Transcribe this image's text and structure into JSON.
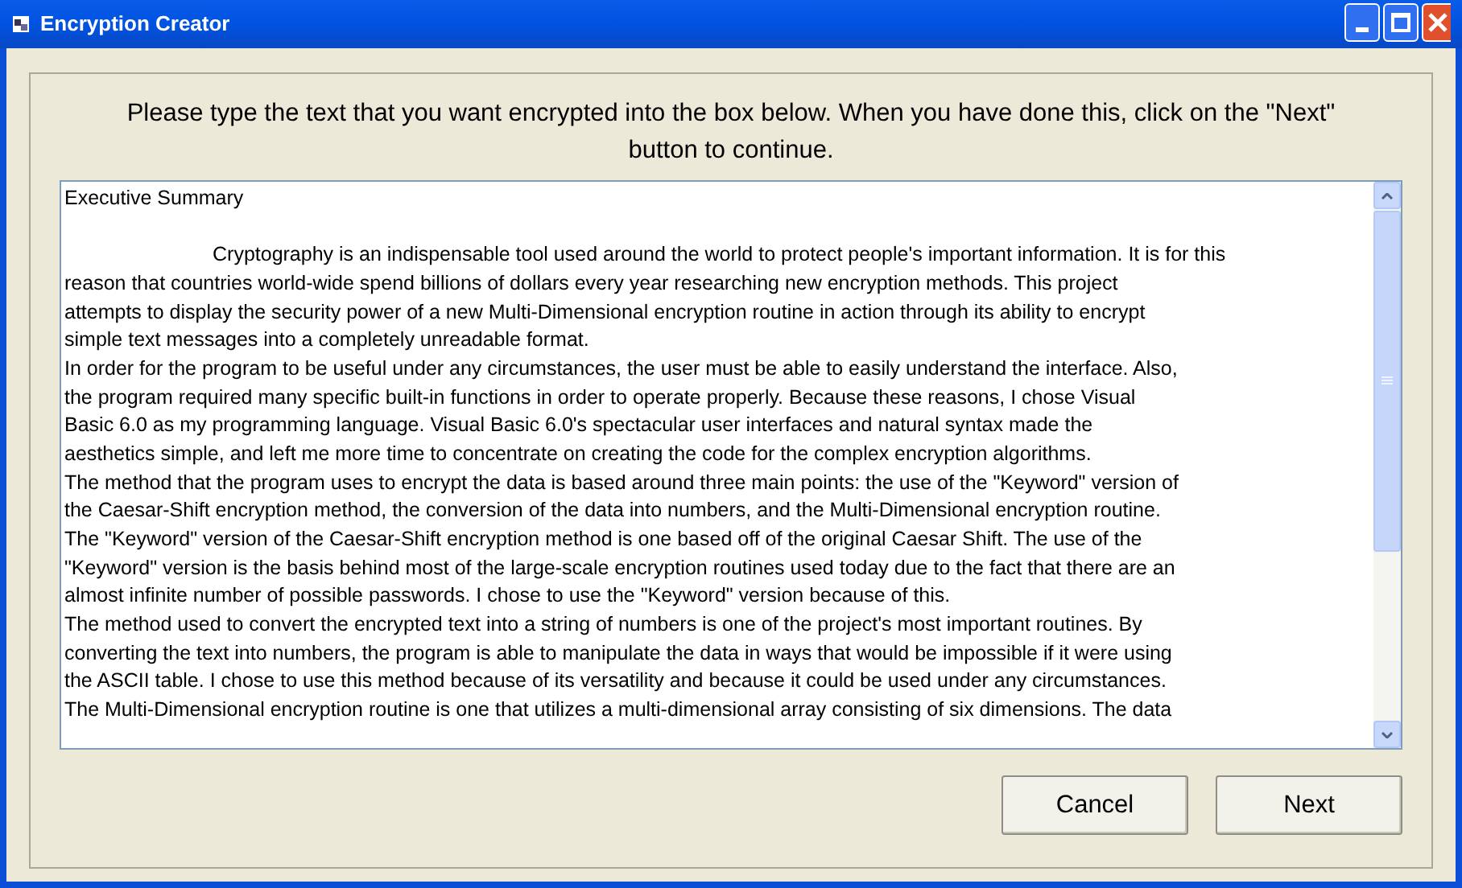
{
  "window": {
    "title": "Encryption Creator"
  },
  "instructions": "Please type the text that you want encrypted into the box below. When you have done this, click on  the \"Next\" button to continue.",
  "text_box": {
    "heading": "Executive Summary",
    "lines": [
      "\tCryptography is an indispensable tool used around the world to protect people's important information. It is for this",
      "reason that countries world-wide spend billions of dollars every year researching new encryption methods. This project",
      "attempts to display the security power of a new Multi-Dimensional encryption routine in action through its ability to encrypt",
      "simple text messages into a completely unreadable format.",
      "In order for the program to be useful under any circumstances, the user must be able to easily understand the interface. Also,",
      "the program required many specific built-in functions in order to operate properly. Because these reasons, I chose Visual",
      "Basic 6.0 as my programming language. Visual Basic 6.0's spectacular user interfaces and natural syntax made the",
      "aesthetics simple, and left me more time to concentrate on creating the code for the complex encryption algorithms.",
      "The method that the program uses to encrypt the data is based around three main points: the use of the \"Keyword\" version of",
      "the Caesar-Shift encryption method, the conversion of the data into numbers, and the Multi-Dimensional encryption routine.",
      "The \"Keyword\" version of the Caesar-Shift encryption method is one based off of the original Caesar Shift. The use of the",
      "\"Keyword\" version is the basis behind most of the large-scale encryption routines used today due to the fact that there are an",
      "almost infinite number of possible passwords. I chose to use the \"Keyword\" version because of this.",
      "The method used to convert the encrypted text into a string of numbers is one of the project's most important routines. By",
      "converting the text into numbers, the program is able to manipulate the data in ways that would be impossible if it were using",
      "the ASCII table. I chose to use this method because of its versatility and because it could be used under any circumstances.",
      "The Multi-Dimensional encryption routine is one that utilizes a multi-dimensional array consisting of six dimensions. The data"
    ]
  },
  "buttons": [
    {
      "label": "Cancel"
    },
    {
      "label": "Next"
    }
  ]
}
